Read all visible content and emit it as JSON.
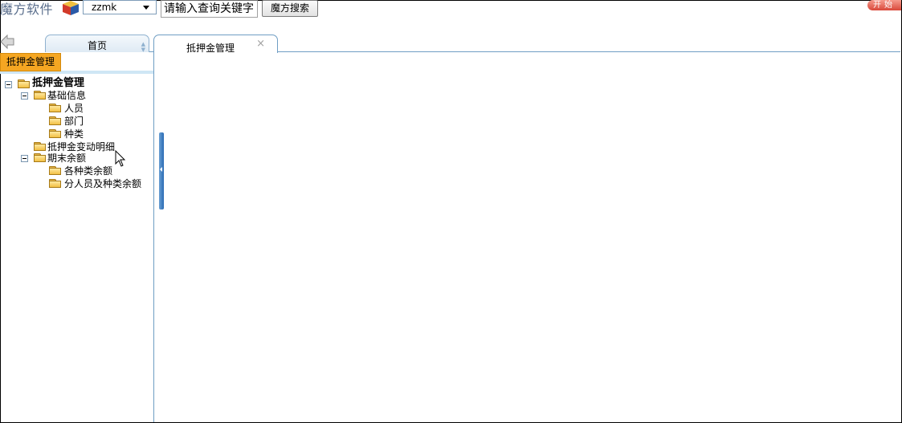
{
  "header": {
    "brand": "魔方软件",
    "user_select": {
      "value": "zzmk"
    },
    "search": {
      "value": "请输入查询关键字"
    },
    "search_button": "魔方搜索",
    "start_button": "开始"
  },
  "tabs": [
    {
      "label": "首页"
    },
    {
      "label": "抵押金管理",
      "close": "×"
    }
  ],
  "left_panel": {
    "header": "抵押金管理",
    "tree": {
      "root": "抵押金管理",
      "groups": [
        {
          "label": "基础信息",
          "children": [
            "人员",
            "部门",
            "种类"
          ]
        },
        {
          "label": "抵押金变动明细"
        },
        {
          "label": "期末余额",
          "children": [
            "各种类余额",
            "分人员及种类余额"
          ]
        }
      ]
    }
  },
  "colors": {
    "left_header": "#f5a622",
    "tab_border": "#6f9ec4",
    "collapse_bar": "#2a6bb4",
    "start_button": "#d9483a"
  }
}
